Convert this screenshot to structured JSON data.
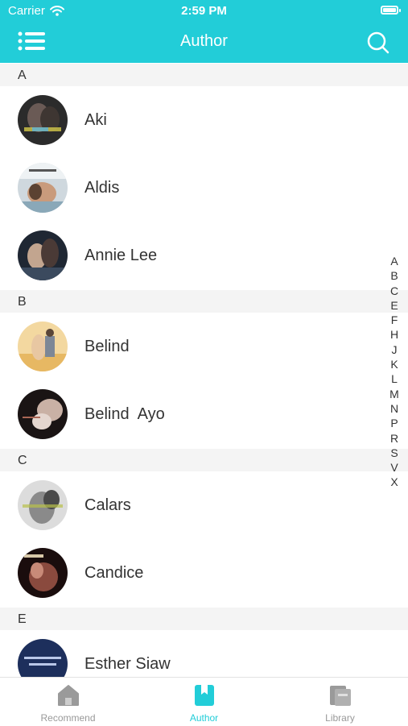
{
  "status_bar": {
    "carrier": "Carrier",
    "time": "2:59 PM"
  },
  "nav": {
    "title": "Author"
  },
  "sections": [
    {
      "letter": "A",
      "authors": [
        {
          "name": "Aki"
        },
        {
          "name": "Aldis"
        },
        {
          "name": "Annie Lee"
        }
      ]
    },
    {
      "letter": "B",
      "authors": [
        {
          "name": "Belind"
        },
        {
          "name": "Belind  Ayo"
        }
      ]
    },
    {
      "letter": "C",
      "authors": [
        {
          "name": "Calars"
        },
        {
          "name": "Candice"
        }
      ]
    },
    {
      "letter": "E",
      "authors": [
        {
          "name": "Esther Siaw"
        }
      ]
    }
  ],
  "index_letters": [
    "A",
    "B",
    "C",
    "E",
    "F",
    "H",
    "J",
    "K",
    "L",
    "M",
    "N",
    "P",
    "R",
    "S",
    "V",
    "X"
  ],
  "tabs": [
    {
      "label": "Recommend",
      "icon": "home-icon"
    },
    {
      "label": "Author",
      "icon": "bookmark-book-icon"
    },
    {
      "label": "Library",
      "icon": "library-icon"
    }
  ],
  "colors": {
    "accent": "#22CDD8",
    "section_bg": "#F4F4F4",
    "text": "#333333",
    "tab_inactive": "#999999"
  }
}
